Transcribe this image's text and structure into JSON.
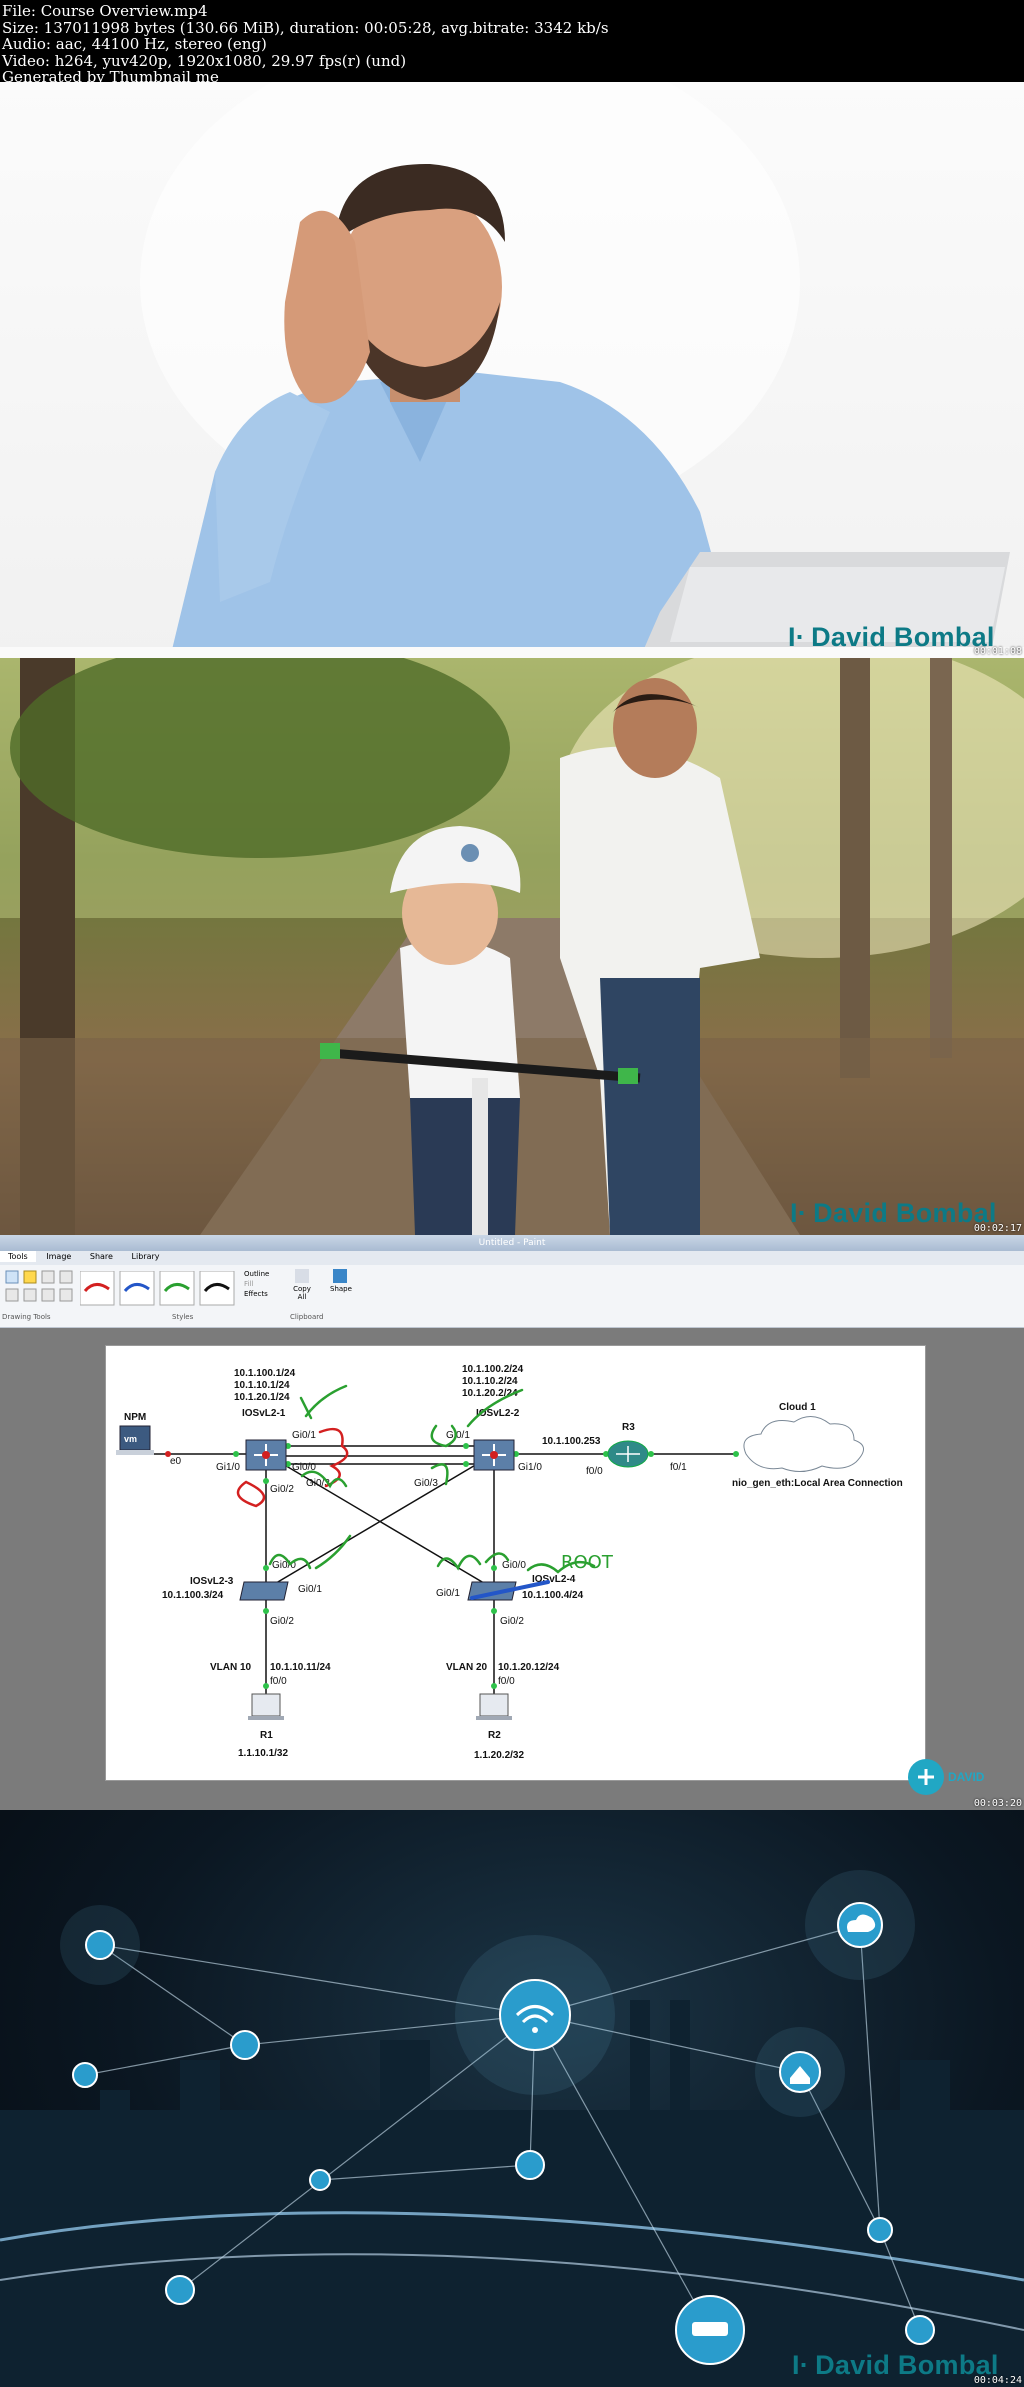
{
  "header": {
    "lines": [
      "File: Course Overview.mp4",
      "Size: 137011998 bytes (130.66 MiB), duration: 00:05:28, avg.bitrate: 3342 kb/s",
      "Audio: aac, 44100 Hz, stereo (eng)",
      "Video: h264, yuv420p, 1920x1080, 29.97 fps(r) (und)",
      "Generated by Thumbnail me"
    ]
  },
  "frames": [
    {
      "timestamp": "00:01:08",
      "brand": "David Bombal",
      "brand_color": "#0d7a86"
    },
    {
      "timestamp": "00:02:17",
      "brand": "David Bombal",
      "brand_color": "#0d7a86"
    },
    {
      "timestamp": "00:03:20",
      "brand_logo_text": "DAVID BOMBAL"
    },
    {
      "timestamp": "00:04:24",
      "brand": "David Bombal",
      "brand_color": "#0d7a86"
    }
  ],
  "paint": {
    "window_title": "Untitled - Paint",
    "tabs": [
      "Tools",
      "Image",
      "Share",
      "Library"
    ],
    "groups": [
      "Drawing Tools",
      "Styles",
      "Clipboard"
    ],
    "buttons": [
      "Outline",
      "Fill",
      "Effects",
      "Copy All",
      "Shape"
    ]
  },
  "topology": {
    "npm": "NPM",
    "vm": "vm",
    "e0": "e0",
    "sw1": "IOSvL2-1",
    "sw1_ips": [
      "10.1.100.1/24",
      "10.1.10.1/24",
      "10.1.20.1/24"
    ],
    "sw2": "IOSvL2-2",
    "sw2_ips": [
      "10.1.100.2/24",
      "10.1.10.2/24",
      "10.1.20.2/24"
    ],
    "sw3": "IOSvL2-3",
    "sw3_ip": "10.1.100.3/24",
    "sw4": "IOSvL2-4",
    "sw4_ip": "10.1.100.4/24",
    "r3": "R3",
    "r3_ip": "10.1.100.253",
    "cloud": "Cloud 1",
    "cloud_conn": "nio_gen_eth:Local Area Connection",
    "ports": {
      "sw1_g10": "Gi1/0",
      "sw1_g01": "Gi0/1",
      "sw1_g00": "Gi0/0",
      "sw1_g03": "Gi0/3",
      "sw1_g02": "Gi0/2",
      "sw2_g01": "Gi0/1",
      "sw2_g10": "Gi1/0",
      "sw2_g03": "Gi0/3",
      "sw3_g00": "Gi0/0",
      "sw3_g01": "Gi0/1",
      "sw3_g02": "Gi0/2",
      "sw4_g00": "Gi0/0",
      "sw4_g01": "Gi0/1",
      "sw4_g02": "Gi0/2",
      "r3_f00": "f0/0",
      "r3_f01": "f0/1",
      "r1_f00": "f0/0",
      "r2_f00": "f0/0"
    },
    "vlan10": "VLAN 10",
    "vlan10_ip": "10.1.10.11/24",
    "vlan20": "VLAN 20",
    "vlan20_ip": "10.1.20.12/24",
    "r1": "R1",
    "r1_ip": "1.1.10.1/32",
    "r2": "R2",
    "r2_ip": "1.1.20.2/32",
    "annotation": "ROOT"
  }
}
